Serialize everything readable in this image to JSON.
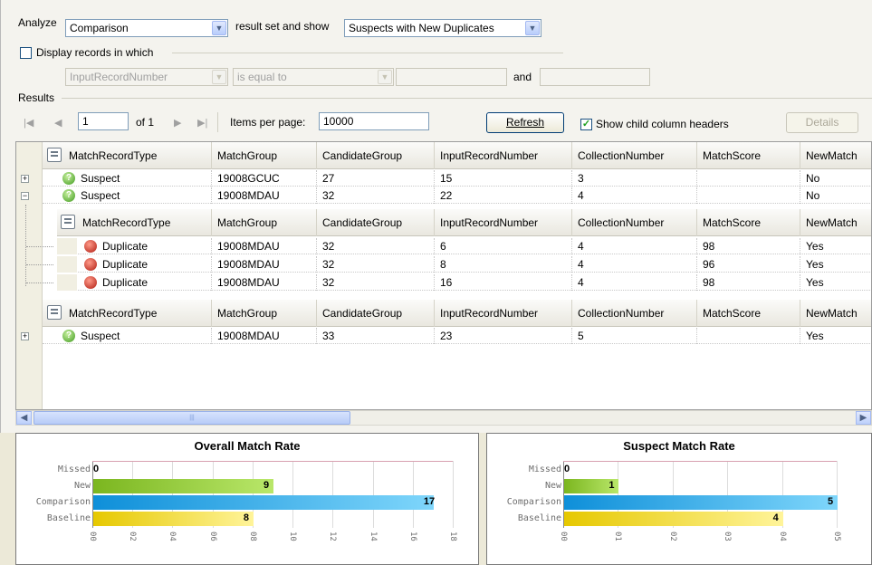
{
  "filter": {
    "analyze_label": "Analyze",
    "analyze_value": "Comparison",
    "result_set_label": "result set and show",
    "show_value": "Suspects with New Duplicates",
    "display_records_label": "Display records in which",
    "field_value": "InputRecordNumber",
    "operator_value": "is equal to",
    "and_label": "and"
  },
  "results": {
    "label": "Results",
    "page_value": "1",
    "of_label": "of 1",
    "items_per_page_label": "Items per page:",
    "items_per_page_value": "10000",
    "refresh_label": "Refresh",
    "show_child_headers_label": "Show child column headers",
    "show_child_headers_checked": true,
    "details_label": "Details"
  },
  "grid": {
    "columns": [
      "MatchRecordType",
      "MatchGroup",
      "CandidateGroup",
      "InputRecordNumber",
      "CollectionNumber",
      "MatchScore",
      "NewMatch"
    ],
    "group1": [
      {
        "type": "Suspect",
        "group": "19008GCUC",
        "candidate": "27",
        "input": "15",
        "collection": "3",
        "score": "",
        "newmatch": "No"
      },
      {
        "type": "Suspect",
        "group": "19008MDAU",
        "candidate": "32",
        "input": "22",
        "collection": "4",
        "score": "",
        "newmatch": "No"
      }
    ],
    "children": [
      {
        "type": "Duplicate",
        "group": "19008MDAU",
        "candidate": "32",
        "input": "6",
        "collection": "4",
        "score": "98",
        "newmatch": "Yes"
      },
      {
        "type": "Duplicate",
        "group": "19008MDAU",
        "candidate": "32",
        "input": "8",
        "collection": "4",
        "score": "96",
        "newmatch": "Yes"
      },
      {
        "type": "Duplicate",
        "group": "19008MDAU",
        "candidate": "32",
        "input": "16",
        "collection": "4",
        "score": "98",
        "newmatch": "Yes"
      }
    ],
    "group2": [
      {
        "type": "Suspect",
        "group": "19008MDAU",
        "candidate": "33",
        "input": "23",
        "collection": "5",
        "score": "",
        "newmatch": "Yes"
      }
    ]
  },
  "chart_data": [
    {
      "type": "bar",
      "title": "Overall Match Rate",
      "categories": [
        "Missed",
        "New",
        "Comparison",
        "Baseline"
      ],
      "values": [
        0,
        9,
        17,
        8
      ],
      "xlim": [
        0,
        18
      ],
      "ticks": [
        "00",
        "02",
        "04",
        "06",
        "08",
        "10",
        "12",
        "14",
        "16",
        "18"
      ],
      "grid": true
    },
    {
      "type": "bar",
      "title": "Suspect Match Rate",
      "categories": [
        "Missed",
        "New",
        "Comparison",
        "Baseline"
      ],
      "values": [
        0,
        1,
        5,
        4
      ],
      "xlim": [
        0,
        5
      ],
      "ticks": [
        "00",
        "01",
        "02",
        "03",
        "04",
        "05"
      ],
      "grid": true
    }
  ]
}
